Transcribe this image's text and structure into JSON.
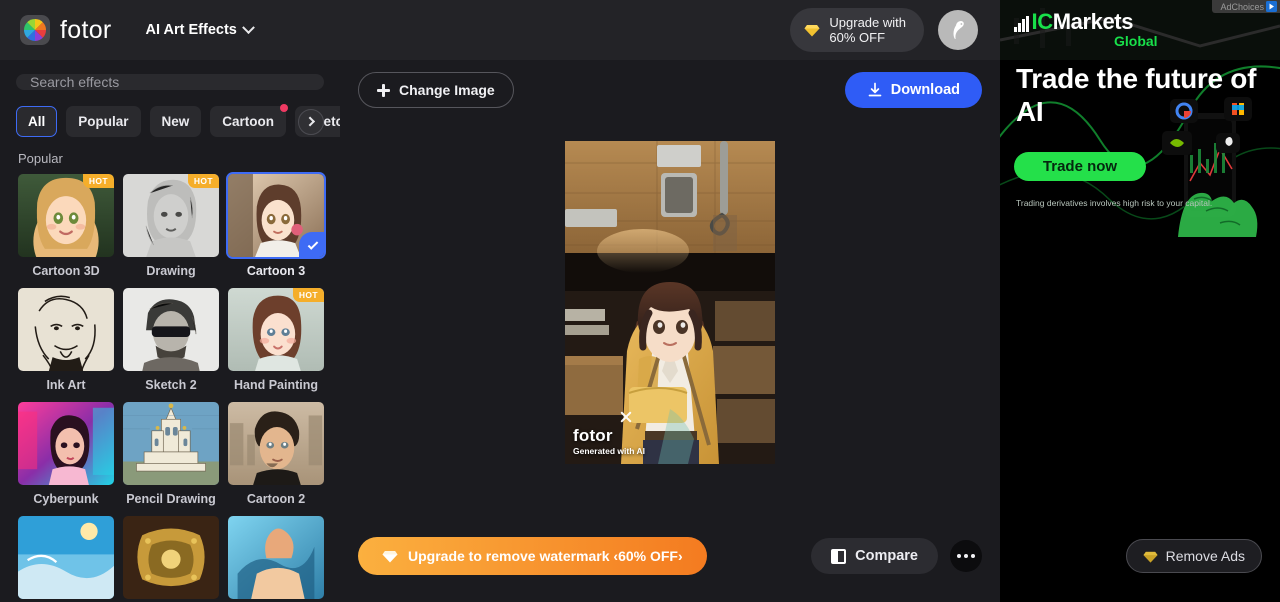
{
  "header": {
    "logo_text": "fotor",
    "logo_icon": "fotor-pinwheel-icon",
    "menu_label": "AI Art Effects",
    "menu_icon": "chevron-down-icon",
    "upgrade_icon": "diamond-icon",
    "upgrade_line1": "Upgrade with",
    "upgrade_line2": "60% OFF",
    "avatar_icon": "bird-avatar-icon"
  },
  "sidebar": {
    "search": {
      "placeholder": "Search effects",
      "value": "",
      "icon": "search-input"
    },
    "chips": [
      {
        "label": "All",
        "active": true,
        "dot": false
      },
      {
        "label": "Popular",
        "active": false,
        "dot": false
      },
      {
        "label": "New",
        "active": false,
        "dot": false
      },
      {
        "label": "Cartoon",
        "active": false,
        "dot": true
      },
      {
        "label": "Sketch",
        "active": false,
        "dot": true
      }
    ],
    "chips_next_icon": "chevron-right-icon",
    "section_title": "Popular",
    "effects": [
      {
        "label": "Cartoon 3D",
        "badge": "HOT",
        "selected": false
      },
      {
        "label": "Drawing",
        "badge": "HOT",
        "selected": false
      },
      {
        "label": "Cartoon 3",
        "badge": "",
        "selected": true
      },
      {
        "label": "Ink Art",
        "badge": "",
        "selected": false
      },
      {
        "label": "Sketch 2",
        "badge": "",
        "selected": false
      },
      {
        "label": "Hand Painting",
        "badge": "HOT",
        "selected": false
      },
      {
        "label": "Cyberpunk",
        "badge": "",
        "selected": false
      },
      {
        "label": "Pencil Drawing",
        "badge": "",
        "selected": false
      },
      {
        "label": "Cartoon 2",
        "badge": "",
        "selected": false
      },
      {
        "label": "",
        "badge": "",
        "selected": false
      },
      {
        "label": "",
        "badge": "",
        "selected": false
      },
      {
        "label": "",
        "badge": "",
        "selected": false
      }
    ]
  },
  "toolbar": {
    "change_image_label": "Change Image",
    "change_image_icon": "plus-icon",
    "download_label": "Download",
    "download_icon": "download-icon"
  },
  "preview": {
    "watermark_text": "fotor",
    "watermark_sub": "Generated with AI",
    "watermark_close_icon": "close-icon"
  },
  "bottom_bar": {
    "upgrade_watermark_label": "Upgrade to remove watermark ‹60% OFF›",
    "upgrade_watermark_icon": "diamond-icon",
    "compare_label": "Compare",
    "compare_icon": "compare-panels-icon",
    "more_icon": "more-options-icon"
  },
  "ad": {
    "adchoices_label": "AdChoices",
    "adchoices_icon": "adchoices-icon",
    "brand_ic": "IC",
    "brand_markets": "Markets",
    "brand_sub": "Global",
    "headline": "Trade the future of AI",
    "cta_label": "Trade now",
    "disclaimer": "Trading derivatives involves high risk to your capital.",
    "remove_ads_label": "Remove Ads",
    "remove_ads_icon": "diamond-icon"
  },
  "colors": {
    "accent_blue": "#2f5cf6",
    "accent_orange": "#f47b20",
    "accent_green": "#24e04a",
    "badge_hot": "#f5ae2a",
    "dot_pink": "#ef3a63"
  }
}
